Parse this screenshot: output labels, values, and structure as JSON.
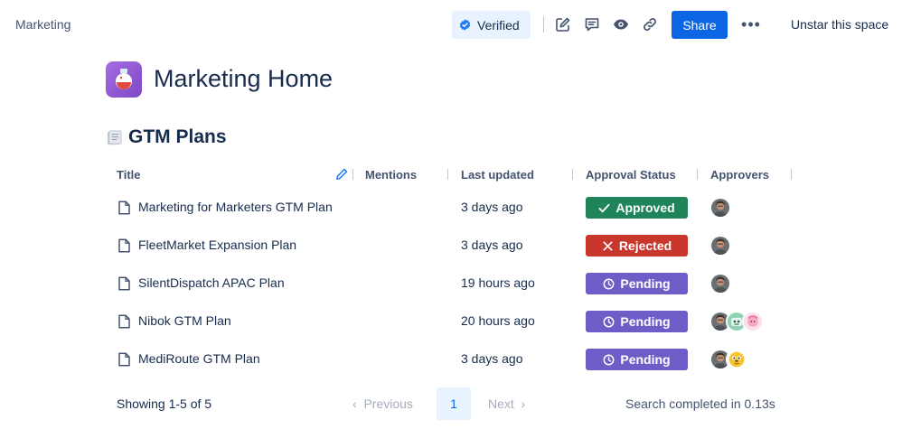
{
  "breadcrumb": "Marketing",
  "toolbar": {
    "verified_label": "Verified",
    "share_label": "Share",
    "more_label": "•••",
    "unstar_label": "Unstar this space",
    "icons": [
      "edit-icon",
      "comment-icon",
      "watch-eye-icon",
      "link-icon"
    ]
  },
  "page": {
    "title": "Marketing Home",
    "section_title": "GTM Plans"
  },
  "table": {
    "columns": [
      "Title",
      "Mentions",
      "Last updated",
      "Approval Status",
      "Approvers"
    ],
    "rows": [
      {
        "title": "Marketing for Marketers GTM Plan",
        "updated": "3 days ago",
        "status": "Approved",
        "status_kind": "approved",
        "approvers": [
          "man-avatar"
        ]
      },
      {
        "title": "FleetMarket Expansion Plan",
        "updated": "3 days ago",
        "status": "Rejected",
        "status_kind": "rejected",
        "approvers": [
          "man-avatar"
        ]
      },
      {
        "title": "SilentDispatch APAC Plan",
        "updated": "19 hours ago",
        "status": "Pending",
        "status_kind": "pending",
        "approvers": [
          "man-avatar"
        ]
      },
      {
        "title": "Nibok GTM Plan",
        "updated": "20 hours ago",
        "status": "Pending",
        "status_kind": "pending",
        "approvers": [
          "man-avatar",
          "robot-avatar",
          "pink-character-avatar"
        ]
      },
      {
        "title": "MediRoute GTM Plan",
        "updated": "3 days ago",
        "status": "Pending",
        "status_kind": "pending",
        "approvers": [
          "man-avatar",
          "yellow-dog-avatar"
        ]
      }
    ]
  },
  "pagination": {
    "showing": "Showing 1-5 of 5",
    "previous": "Previous",
    "current_page": "1",
    "next": "Next",
    "search_info": "Search completed in 0.13s"
  },
  "colors": {
    "primary": "#0c66e4",
    "approved": "#1f845a",
    "rejected": "#c9372c",
    "pending": "#6e5dc6"
  }
}
